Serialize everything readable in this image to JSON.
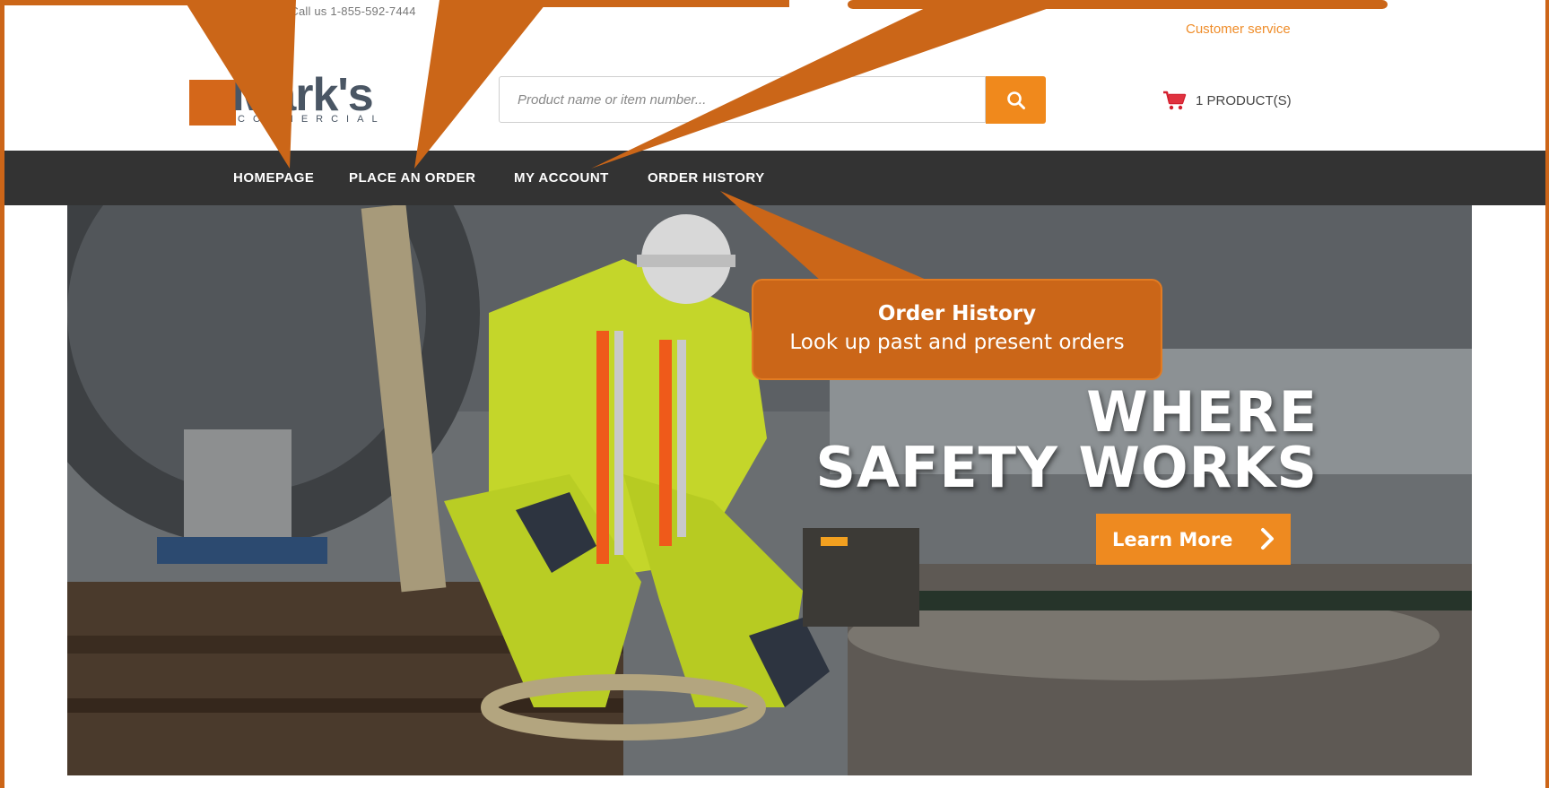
{
  "topbar": {
    "phone_text": "ns? Call us 1-855-592-7444",
    "customer_service": "Customer service"
  },
  "logo": {
    "brand": "Mark's",
    "subtitle": "COMMERCIAL"
  },
  "search": {
    "placeholder": "Product name or item number...",
    "icon": "search-icon"
  },
  "cart": {
    "label": "1 PRODUCT(S)",
    "icon": "cart-icon"
  },
  "nav": {
    "items": [
      {
        "label": "HOMEPAGE"
      },
      {
        "label": "PLACE AN ORDER"
      },
      {
        "label": "MY ACCOUNT"
      },
      {
        "label": "ORDER HISTORY"
      }
    ]
  },
  "hero": {
    "heading_line1": "WHERE",
    "heading_line2": "SAFETY WORKS",
    "cta_label": "Learn More"
  },
  "callout": {
    "title": "Order History",
    "description": "Look up past and present orders"
  },
  "colors": {
    "accent_orange": "#f0891c",
    "callout_orange": "#cb6618",
    "nav_background": "#333333",
    "logo_text": "#4a5664"
  }
}
